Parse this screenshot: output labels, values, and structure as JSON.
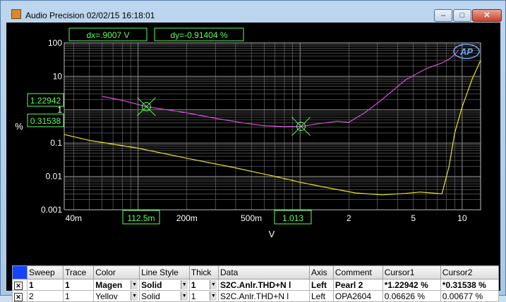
{
  "window": {
    "title": "Audio Precision  02/02/15 16:18:01",
    "controls": {
      "minimize": "–",
      "maximize": "□",
      "close": "✕"
    }
  },
  "plot": {
    "dx_readout": "dx=.9007   V",
    "dy_readout": "dy=-0.91404 %",
    "cursor1_y_readout": "1.22942",
    "cursor2_y_readout": "0.31538",
    "cursor1_x_readout": "112.5m",
    "cursor2_x_readout": "1.013",
    "logo_text": "AP",
    "y_axis_label": "%",
    "x_axis_label": "V",
    "y_ticks": [
      "100",
      "10",
      "1",
      "0.1",
      "0.01",
      "0.001"
    ],
    "x_ticks": [
      "40m",
      "200m",
      "500m",
      "2",
      "5",
      "10"
    ],
    "colors": {
      "background": "#000000",
      "grid": "#8c8c8c",
      "text": "#ffffff",
      "readout": "#5cff5c",
      "trace1": "#d64fd6",
      "trace2": "#e6e61e"
    }
  },
  "chart_data": {
    "type": "line",
    "xlabel": "V",
    "ylabel": "%",
    "x_scale": "log",
    "y_scale": "log",
    "xlim": [
      0.035,
      13
    ],
    "ylim": [
      0.001,
      100
    ],
    "grid": true,
    "series": [
      {
        "name": "Pearl 2",
        "color": "#d64fd6",
        "x": [
          0.06,
          0.08,
          0.1125,
          0.15,
          0.2,
          0.3,
          0.45,
          0.6,
          0.8,
          1.013,
          1.3,
          1.7,
          2.0,
          2.5,
          3.2,
          4.5,
          6.0,
          7.5,
          8.5,
          9.5
        ],
        "y": [
          2.5,
          1.9,
          1.22942,
          1.0,
          0.8,
          0.55,
          0.4,
          0.33,
          0.31,
          0.31538,
          0.38,
          0.45,
          0.42,
          0.8,
          2.0,
          8.0,
          17.0,
          25.0,
          35.0,
          60.0
        ]
      },
      {
        "name": "OPA2604",
        "color": "#e6e61e",
        "x": [
          0.035,
          0.05,
          0.1,
          0.2,
          0.4,
          0.7,
          1.013,
          1.5,
          2.2,
          3.2,
          4.5,
          5.5,
          6.5,
          7.5,
          8.3,
          9.0,
          10.0,
          11.5,
          13.0
        ],
        "y": [
          0.18,
          0.12,
          0.07,
          0.035,
          0.018,
          0.01,
          0.0066,
          0.0045,
          0.0032,
          0.0028,
          0.0031,
          0.0034,
          0.0032,
          0.003,
          0.02,
          0.2,
          1.2,
          8.0,
          30.0
        ]
      }
    ]
  },
  "table": {
    "headers": [
      "Sweep",
      "Trace",
      "Color",
      "Line Style",
      "Thick",
      "Data",
      "Axis",
      "Comment",
      "Cursor1",
      "Cursor2"
    ],
    "rows": [
      {
        "checked": "✕",
        "sweep": "1",
        "trace": "1",
        "color": "Magen",
        "line_style": "Solid",
        "thick": "1",
        "data": "S2C.Anlr.THD+N l",
        "axis": "Left",
        "comment": "Pearl 2",
        "cursor1": "*1.22942  %",
        "cursor2": "*0.31538  %"
      },
      {
        "checked": "✕",
        "sweep": "2",
        "trace": "1",
        "color": "Yellov",
        "line_style": "Solid",
        "thick": "1",
        "data": "S2C.Anlr.THD+N l",
        "axis": "Left",
        "comment": "OPA2604",
        "cursor1": "0.06626  %",
        "cursor2": "0.00677  %"
      }
    ]
  }
}
